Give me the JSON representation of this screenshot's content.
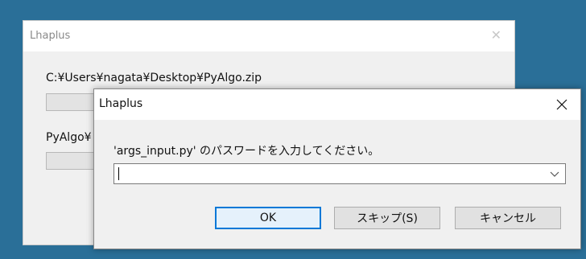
{
  "background_window": {
    "title": "Lhaplus",
    "close_symbol": "✕",
    "file_path": "C:¥Users¥nagata¥Desktop¥PyAlgo.zip",
    "label": "PyAlgo¥"
  },
  "dialog": {
    "title": "Lhaplus",
    "close_symbol": "✕",
    "prompt": "'args_input.py' のパスワードを入力してください。",
    "password_value": "",
    "buttons": {
      "ok": "OK",
      "skip": "スキップ(S)",
      "cancel": "キャンセル"
    }
  },
  "icons": {
    "close": "close-icon",
    "dropdown": "chevron-down-icon"
  },
  "colors": {
    "desktop": "#2a6f98",
    "window_bg": "#f0f0f0",
    "default_button_border": "#0078d7"
  }
}
